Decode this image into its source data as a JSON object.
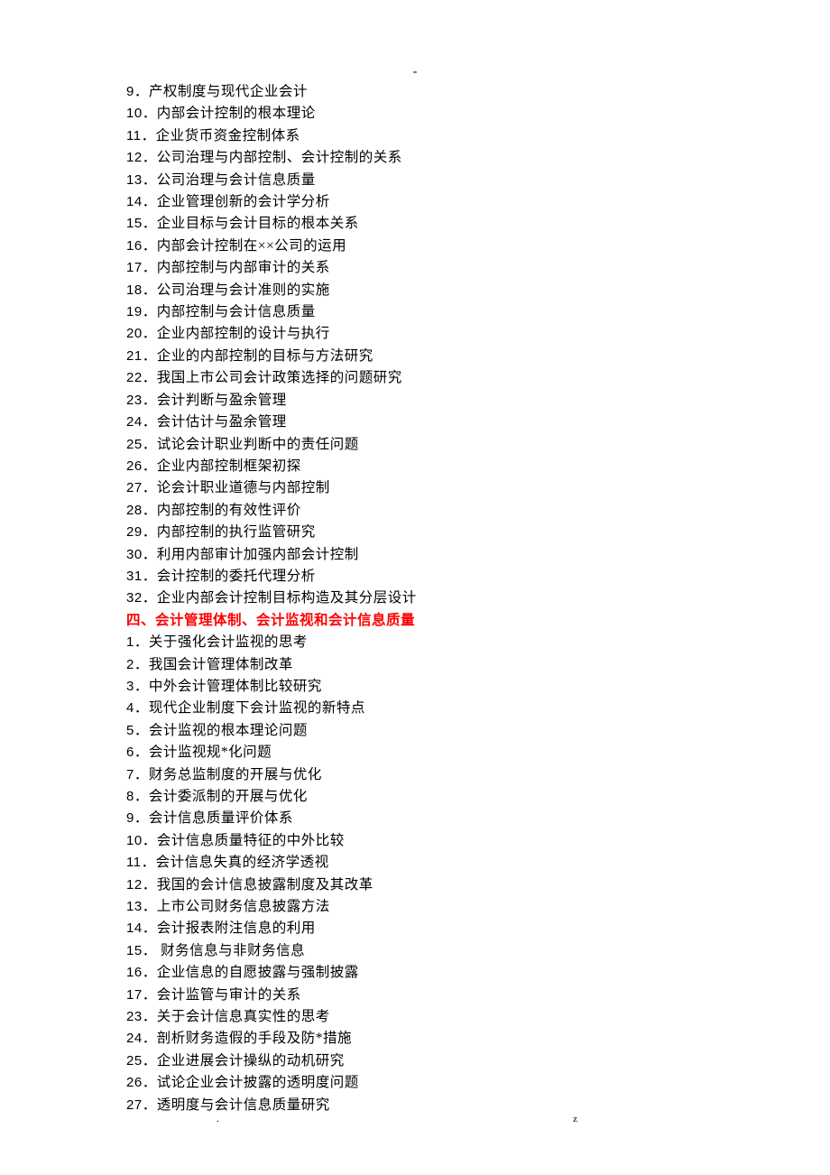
{
  "top_marker": "-",
  "section1": {
    "items": [
      {
        "num": "9",
        "text": "产权制度与现代企业会计"
      },
      {
        "num": "10",
        "text": "内部会计控制的根本理论"
      },
      {
        "num": "11",
        "text": "企业货币资金控制体系"
      },
      {
        "num": "12",
        "text": "公司治理与内部控制、会计控制的关系"
      },
      {
        "num": "13",
        "text": "公司治理与会计信息质量"
      },
      {
        "num": "14",
        "text": "企业管理创新的会计学分析"
      },
      {
        "num": "15",
        "text": "企业目标与会计目标的根本关系"
      },
      {
        "num": "16",
        "text": "内部会计控制在××公司的运用"
      },
      {
        "num": "17",
        "text": "内部控制与内部审计的关系"
      },
      {
        "num": "18",
        "text": "公司治理与会计准则的实施"
      },
      {
        "num": "19",
        "text": "内部控制与会计信息质量"
      },
      {
        "num": "20",
        "text": "企业内部控制的设计与执行"
      },
      {
        "num": "21",
        "text": "企业的内部控制的目标与方法研究"
      },
      {
        "num": "22",
        "text": "我国上市公司会计政策选择的问题研究"
      },
      {
        "num": "23",
        "text": "会计判断与盈余管理"
      },
      {
        "num": "24",
        "text": "会计估计与盈余管理"
      },
      {
        "num": "25",
        "text": "试论会计职业判断中的责任问题"
      },
      {
        "num": "26",
        "text": "企业内部控制框架初探"
      },
      {
        "num": "27",
        "text": "论会计职业道德与内部控制"
      },
      {
        "num": "28",
        "text": "内部控制的有效性评价"
      },
      {
        "num": "29",
        "text": "内部控制的执行监管研究"
      },
      {
        "num": "30",
        "text": "利用内部审计加强内部会计控制"
      },
      {
        "num": "31",
        "text": "会计控制的委托代理分析"
      },
      {
        "num": "32",
        "text": "企业内部会计控制目标构造及其分层设计"
      }
    ]
  },
  "heading": "四、会计管理体制、会计监视和会计信息质量",
  "section2": {
    "items": [
      {
        "num": "1",
        "text": "关于强化会计监视的思考"
      },
      {
        "num": "2",
        "text": "我国会计管理体制改革"
      },
      {
        "num": "3",
        "text": "中外会计管理体制比较研究"
      },
      {
        "num": "4",
        "text": "现代企业制度下会计监视的新特点"
      },
      {
        "num": "5",
        "text": "会计监视的根本理论问题"
      },
      {
        "num": "6",
        "text": "会计监视规*化问题"
      },
      {
        "num": "7",
        "text": "财务总监制度的开展与优化"
      },
      {
        "num": "8",
        "text": "会计委派制的开展与优化"
      },
      {
        "num": "9",
        "text": "会计信息质量评价体系"
      },
      {
        "num": "10",
        "text": "会计信息质量特征的中外比较"
      },
      {
        "num": "11",
        "text": "会计信息失真的经济学透视"
      },
      {
        "num": "12",
        "text": "我国的会计信息披露制度及其改革"
      },
      {
        "num": "13",
        "text": "上市公司财务信息披露方法"
      },
      {
        "num": "14",
        "text": "会计报表附注信息的利用"
      },
      {
        "num": "15",
        "text": " 财务信息与非财务信息"
      },
      {
        "num": "16",
        "text": "企业信息的自愿披露与强制披露"
      },
      {
        "num": "17",
        "text": "会计监管与审计的关系"
      },
      {
        "num": "23",
        "text": "关于会计信息真实性的思考"
      },
      {
        "num": "24",
        "text": "剖析财务造假的手段及防*措施"
      },
      {
        "num": "25",
        "text": "企业进展会计操纵的动机研究"
      },
      {
        "num": "26",
        "text": "试论企业会计披露的透明度问题"
      },
      {
        "num": "27",
        "text": "透明度与会计信息质量研究"
      }
    ]
  },
  "footer": {
    "left": ".",
    "right": "z"
  }
}
